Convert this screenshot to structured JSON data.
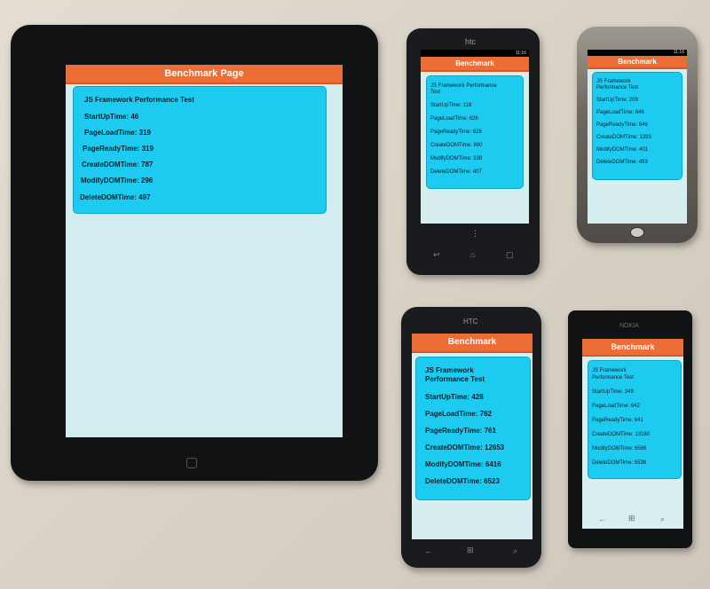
{
  "devices": {
    "ipad": {
      "title": "Benchmark Page",
      "heading": "JS Framework Performance Test",
      "metrics": [
        {
          "label": "StartUpTime:",
          "value": "46"
        },
        {
          "label": "PageLoadTime:",
          "value": "319"
        },
        {
          "label": "PageReadyTime:",
          "value": "319"
        },
        {
          "label": "CreateDOMTime:",
          "value": "787"
        },
        {
          "label": "ModifyDOMTime:",
          "value": "296"
        },
        {
          "label": "DeleteDOMTime:",
          "value": "497"
        }
      ]
    },
    "htc_one_v": {
      "brand": "htc",
      "status_time": "11:16",
      "title": "Benchmark",
      "heading_1": "JS Framework Performance",
      "heading_2": "Test",
      "metrics": [
        {
          "label": "StartUpTime:",
          "value": "118"
        },
        {
          "label": "PageLoadTime:",
          "value": "626"
        },
        {
          "label": "PageReadyTime:",
          "value": "626"
        },
        {
          "label": "CreateDOMTime:",
          "value": "890"
        },
        {
          "label": "ModifyDOMTime:",
          "value": "338"
        },
        {
          "label": "DeleteDOMTime:",
          "value": "407"
        }
      ]
    },
    "nexus_one": {
      "status_time": "11:16",
      "title": "Benchmark",
      "heading_1": "JS Framework",
      "heading_2": "Performance Test",
      "metrics": [
        {
          "label": "StartUpTime:",
          "value": "209"
        },
        {
          "label": "PageLoadTime:",
          "value": "646"
        },
        {
          "label": "PageReadyTime:",
          "value": "646"
        },
        {
          "label": "CreateDOMTime:",
          "value": "1393"
        },
        {
          "label": "ModifyDOMTime:",
          "value": "401"
        },
        {
          "label": "DeleteDOMTime:",
          "value": "493"
        }
      ]
    },
    "htc_wp": {
      "brand": "HTC",
      "title": "Benchmark",
      "heading_1": "JS Framework",
      "heading_2": "Performance Test",
      "metrics": [
        {
          "label": "StartUpTime:",
          "value": "428"
        },
        {
          "label": "PageLoadTime:",
          "value": "762"
        },
        {
          "label": "PageReadyTime:",
          "value": "761"
        },
        {
          "label": "CreateDOMTime:",
          "value": "12653"
        },
        {
          "label": "ModifyDOMTime:",
          "value": "6416"
        },
        {
          "label": "DeleteDOMTime:",
          "value": "6523"
        }
      ]
    },
    "nokia": {
      "brand": "NOKIA",
      "title": "Benchmark",
      "heading_1": "JS Framework",
      "heading_2": "Performance Test",
      "metrics": [
        {
          "label": "StartUpTime:",
          "value": "349"
        },
        {
          "label": "PageLoadTime:",
          "value": "642"
        },
        {
          "label": "PageReadyTime:",
          "value": "641"
        },
        {
          "label": "CreateDOMTime:",
          "value": "13160"
        },
        {
          "label": "ModifyDOMTime:",
          "value": "6588"
        },
        {
          "label": "DeleteDOMTime:",
          "value": "6536"
        }
      ]
    }
  }
}
